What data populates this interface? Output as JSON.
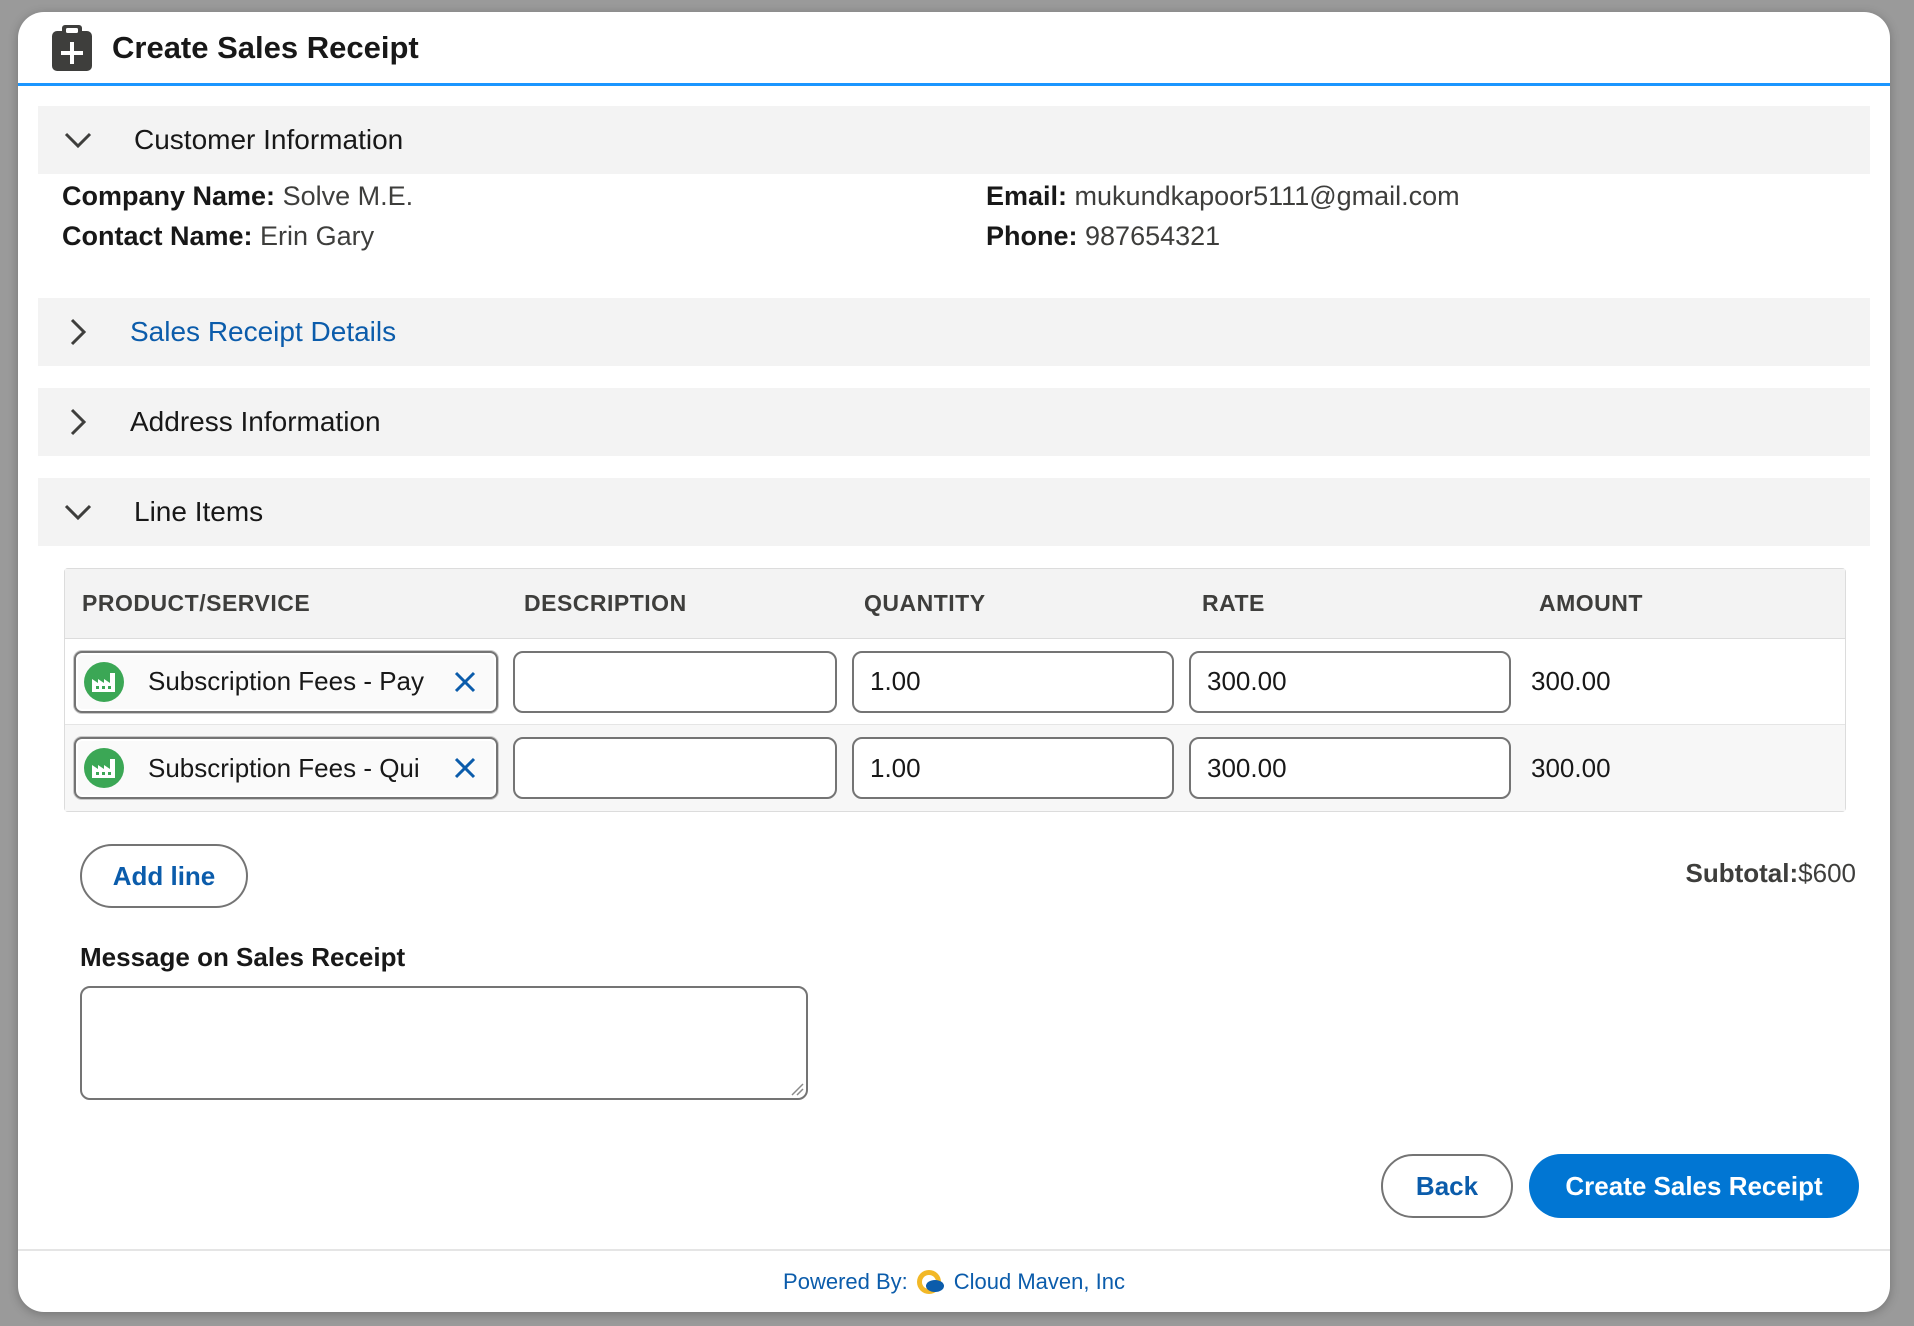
{
  "modal": {
    "title": "Create Sales Receipt",
    "title_icon": "clipboard-add-icon",
    "accent_color": "#1b96ff"
  },
  "sections": {
    "customer": {
      "label": "Customer Information",
      "expanded": true
    },
    "details": {
      "label": "Sales Receipt Details",
      "expanded": false
    },
    "address": {
      "label": "Address Information",
      "expanded": false
    },
    "line_items": {
      "label": "Line Items",
      "expanded": true
    }
  },
  "customer": {
    "company_label": "Company Name:",
    "company_value": "Solve M.E.",
    "contact_label": "Contact Name:",
    "contact_value": "Erin Gary",
    "email_label": "Email:",
    "email_value": "mukundkapoor5111@gmail.com",
    "phone_label": "Phone:",
    "phone_value": "987654321"
  },
  "table": {
    "headers": [
      "PRODUCT/SERVICE",
      "DESCRIPTION",
      "QUANTITY",
      "RATE",
      "AMOUNT"
    ],
    "rows": [
      {
        "product": "Subscription Fees - Pay",
        "description": "",
        "quantity": "1.00",
        "rate": "300.00",
        "amount": "300.00"
      },
      {
        "product": "Subscription Fees - Qui",
        "description": "",
        "quantity": "1.00",
        "rate": "300.00",
        "amount": "300.00"
      }
    ]
  },
  "actions": {
    "add_line": "Add line",
    "subtotal_label": "Subtotal:",
    "subtotal_value": "$600",
    "message_label": "Message on Sales Receipt",
    "message_value": "",
    "back": "Back",
    "create": "Create Sales Receipt",
    "primary_color": "#0176d3"
  },
  "footer": {
    "powered_by": "Powered By:",
    "company": "Cloud Maven, Inc"
  }
}
